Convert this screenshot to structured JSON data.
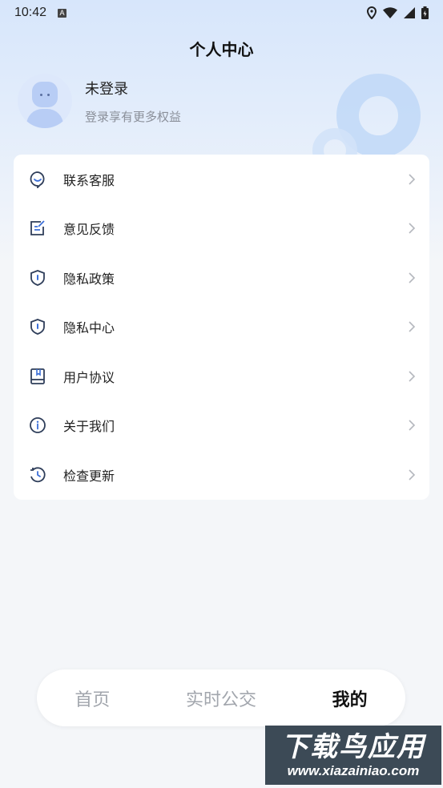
{
  "status_bar": {
    "time": "10:42",
    "notification_letter": "A"
  },
  "header": {
    "title": "个人中心"
  },
  "profile": {
    "name": "未登录",
    "subtitle": "登录享有更多权益"
  },
  "menu": [
    {
      "label": "联系客服",
      "icon": "customer-service-icon"
    },
    {
      "label": "意见反馈",
      "icon": "feedback-icon"
    },
    {
      "label": "隐私政策",
      "icon": "shield-icon"
    },
    {
      "label": "隐私中心",
      "icon": "shield-icon"
    },
    {
      "label": "用户协议",
      "icon": "agreement-icon"
    },
    {
      "label": "关于我们",
      "icon": "info-icon"
    },
    {
      "label": "检查更新",
      "icon": "update-icon"
    }
  ],
  "tabs": [
    {
      "label": "首页",
      "active": false
    },
    {
      "label": "实时公交",
      "active": false
    },
    {
      "label": "我的",
      "active": true
    }
  ],
  "watermark": {
    "title": "下载鸟应用",
    "url": "www.xiazainiao.com"
  },
  "colors": {
    "accent": "#3c6fd8",
    "icon": "#2f3e5a",
    "background": "#f4f6f9"
  }
}
